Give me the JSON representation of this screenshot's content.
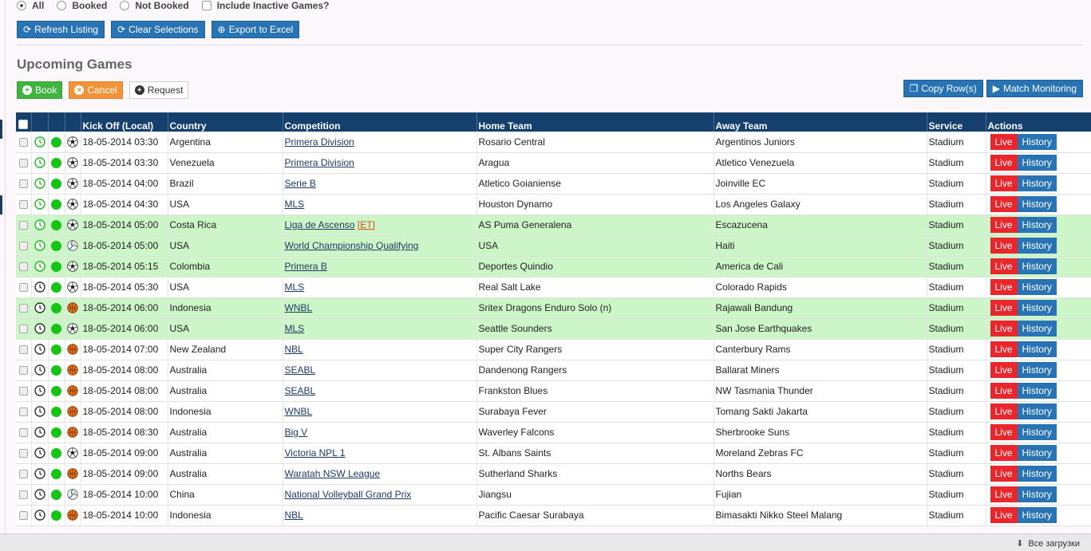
{
  "filters": {
    "all": "All",
    "booked": "Booked",
    "not_booked": "Not Booked",
    "include_inactive": "Include Inactive Games?"
  },
  "toolbar": {
    "refresh": "Refresh Listing",
    "clear": "Clear Selections",
    "export": "Export to Excel"
  },
  "section_title": "Upcoming Games",
  "actions": {
    "book": "Book",
    "cancel": "Cancel",
    "request": "Request",
    "copy_rows": "Copy Row(s)",
    "match_monitoring": "Match Monitoring"
  },
  "table": {
    "headers": {
      "kickoff": "Kick Off (Local)",
      "country": "Country",
      "competition": "Competition",
      "home": "Home Team",
      "away": "Away Team",
      "service": "Service",
      "actions": "Actions"
    },
    "live_label": "Live",
    "history_label": "History",
    "rows": [
      {
        "kickoff": "18-05-2014 03:30",
        "country": "Argentina",
        "competition": "Primera Division",
        "tag": "",
        "home": "Rosario Central",
        "away": "Argentinos Juniors",
        "service": "Stadium",
        "clock": "green",
        "sport": "soccer",
        "highlight": false
      },
      {
        "kickoff": "18-05-2014 03:30",
        "country": "Venezuela",
        "competition": "Primera Division",
        "tag": "",
        "home": "Aragua",
        "away": "Atletico Venezuela",
        "service": "Stadium",
        "clock": "green",
        "sport": "soccer",
        "highlight": false
      },
      {
        "kickoff": "18-05-2014 04:00",
        "country": "Brazil",
        "competition": "Serie B",
        "tag": "",
        "home": "Atletico Goianiense",
        "away": "Joinville EC",
        "service": "Stadium",
        "clock": "green",
        "sport": "soccer",
        "highlight": false
      },
      {
        "kickoff": "18-05-2014 04:30",
        "country": "USA",
        "competition": "MLS",
        "tag": "",
        "home": "Houston Dynamo",
        "away": "Los Angeles Galaxy",
        "service": "Stadium",
        "clock": "green",
        "sport": "soccer",
        "highlight": false
      },
      {
        "kickoff": "18-05-2014 05:00",
        "country": "Costa Rica",
        "competition": "Liga de Ascenso",
        "tag": "[ET]",
        "home": "AS Puma Generalena",
        "away": "Escazucena",
        "service": "Stadium",
        "clock": "green",
        "sport": "soccer",
        "highlight": true
      },
      {
        "kickoff": "18-05-2014 05:00",
        "country": "USA",
        "competition": "World Championship Qualifying",
        "tag": "",
        "home": "USA",
        "away": "Haiti",
        "service": "Stadium",
        "clock": "green",
        "sport": "volleyball",
        "highlight": true
      },
      {
        "kickoff": "18-05-2014 05:15",
        "country": "Colombia",
        "competition": "Primera B",
        "tag": "",
        "home": "Deportes Quindio",
        "away": "America de Cali",
        "service": "Stadium",
        "clock": "green",
        "sport": "soccer",
        "highlight": true
      },
      {
        "kickoff": "18-05-2014 05:30",
        "country": "USA",
        "competition": "MLS",
        "tag": "",
        "home": "Real Salt Lake",
        "away": "Colorado Rapids",
        "service": "Stadium",
        "clock": "dark",
        "sport": "soccer",
        "highlight": false
      },
      {
        "kickoff": "18-05-2014 06:00",
        "country": "Indonesia",
        "competition": "WNBL",
        "tag": "",
        "home": "Sritex Dragons Enduro Solo (n)",
        "away": "Rajawali Bandung",
        "service": "Stadium",
        "clock": "dark",
        "sport": "basketball",
        "highlight": true
      },
      {
        "kickoff": "18-05-2014 06:00",
        "country": "USA",
        "competition": "MLS",
        "tag": "",
        "home": "Seattle Sounders",
        "away": "San Jose Earthquakes",
        "service": "Stadium",
        "clock": "dark",
        "sport": "soccer",
        "highlight": true
      },
      {
        "kickoff": "18-05-2014 07:00",
        "country": "New Zealand",
        "competition": "NBL",
        "tag": "",
        "home": "Super City Rangers",
        "away": "Canterbury Rams",
        "service": "Stadium",
        "clock": "dark",
        "sport": "basketball",
        "highlight": false
      },
      {
        "kickoff": "18-05-2014 08:00",
        "country": "Australia",
        "competition": "SEABL",
        "tag": "",
        "home": "Dandenong Rangers",
        "away": "Ballarat Miners",
        "service": "Stadium",
        "clock": "dark",
        "sport": "basketball",
        "highlight": false
      },
      {
        "kickoff": "18-05-2014 08:00",
        "country": "Australia",
        "competition": "SEABL",
        "tag": "",
        "home": "Frankston Blues",
        "away": "NW Tasmania Thunder",
        "service": "Stadium",
        "clock": "dark",
        "sport": "basketball",
        "highlight": false
      },
      {
        "kickoff": "18-05-2014 08:00",
        "country": "Indonesia",
        "competition": "WNBL",
        "tag": "",
        "home": "Surabaya Fever",
        "away": "Tomang Sakti Jakarta",
        "service": "Stadium",
        "clock": "dark",
        "sport": "basketball",
        "highlight": false
      },
      {
        "kickoff": "18-05-2014 08:30",
        "country": "Australia",
        "competition": "Big V",
        "tag": "",
        "home": "Waverley Falcons",
        "away": "Sherbrooke Suns",
        "service": "Stadium",
        "clock": "dark",
        "sport": "basketball",
        "highlight": false
      },
      {
        "kickoff": "18-05-2014 09:00",
        "country": "Australia",
        "competition": "Victoria NPL 1",
        "tag": "",
        "home": "St. Albans Saints",
        "away": "Moreland Zebras FC",
        "service": "Stadium",
        "clock": "dark",
        "sport": "soccer",
        "highlight": false
      },
      {
        "kickoff": "18-05-2014 09:00",
        "country": "Australia",
        "competition": "Waratah NSW League",
        "tag": "",
        "home": "Sutherland Sharks",
        "away": "Norths Bears",
        "service": "Stadium",
        "clock": "dark",
        "sport": "basketball",
        "highlight": false
      },
      {
        "kickoff": "18-05-2014 10:00",
        "country": "China",
        "competition": "National Volleyball Grand Prix",
        "tag": "",
        "home": "Jiangsu",
        "away": "Fujian",
        "service": "Stadium",
        "clock": "dark",
        "sport": "volleyball",
        "highlight": false
      },
      {
        "kickoff": "18-05-2014 10:00",
        "country": "Indonesia",
        "competition": "NBL",
        "tag": "",
        "home": "Pacific Caesar Surabaya",
        "away": "Bimasakti Nikko Steel Malang",
        "service": "Stadium",
        "clock": "dark",
        "sport": "basketball",
        "highlight": false
      }
    ]
  },
  "downloads": {
    "label": "Все загрузки"
  },
  "colors": {
    "header_bg": "#153f6d",
    "button_blue": "#2873b4",
    "live_red": "#e8262c",
    "row_highlight": "#ccf5c8",
    "status_green": "#16c416"
  }
}
